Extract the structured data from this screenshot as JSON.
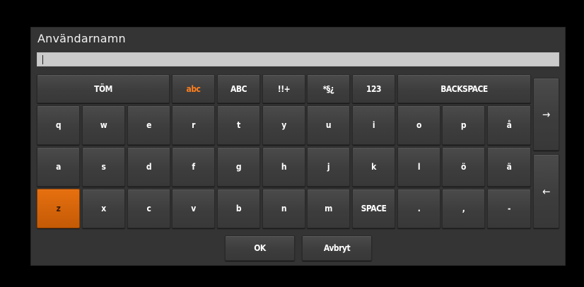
{
  "dialog": {
    "title": "Användarnamn",
    "input_value": ""
  },
  "keyboard": {
    "clear": "TÖM",
    "mode_abc": "abc",
    "mode_ABC": "ABC",
    "mode_sym1": "!!+",
    "mode_sym2": "*§¿",
    "mode_num": "123",
    "backspace": "BACKSPACE",
    "row1": [
      "q",
      "w",
      "e",
      "r",
      "t",
      "y",
      "u",
      "i",
      "o",
      "p",
      "å"
    ],
    "row2": [
      "a",
      "s",
      "d",
      "f",
      "g",
      "h",
      "j",
      "k",
      "l",
      "ö",
      "ä"
    ],
    "row3": [
      "z",
      "x",
      "c",
      "v",
      "b",
      "n",
      "m",
      "SPACE",
      ".",
      ",",
      "-"
    ],
    "right_arrow": "→",
    "left_arrow": "←",
    "ok": "OK",
    "cancel": "Avbryt",
    "accent_color": "#ff7f1f",
    "active_key": "z"
  }
}
